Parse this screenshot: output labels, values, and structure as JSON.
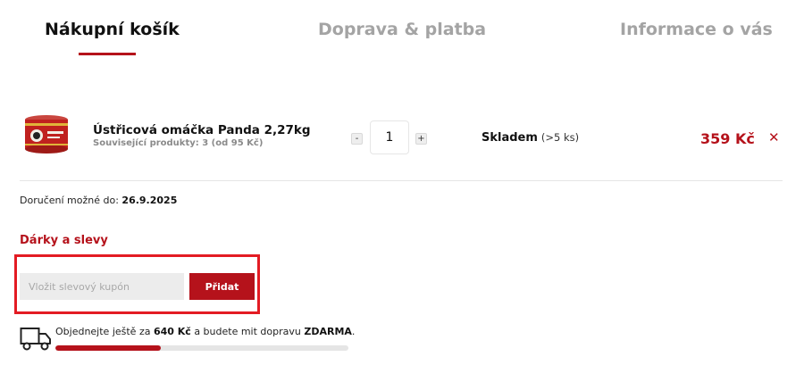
{
  "steps": [
    {
      "label": "Nákupní košík",
      "active": true
    },
    {
      "label": "Doprava & platba",
      "active": false
    },
    {
      "label": "Informace o vás",
      "active": false
    }
  ],
  "cart_item": {
    "name": "Ústřicová omáčka Panda 2,27kg",
    "related": "Související produkty: 3 (od 95 Kč)",
    "quantity": "1",
    "minus_label": "-",
    "plus_label": "+",
    "stock_label": "Skladem",
    "stock_count": "(>5 ks)",
    "price": "359 Kč",
    "remove_label": "✕",
    "image_icon": "product-can-icon"
  },
  "delivery": {
    "label": "Doručení možné do:",
    "date": "26.9.2025"
  },
  "gifts": {
    "title": "Dárky a slevy",
    "coupon_placeholder": "Vložit slevový kupón",
    "add_label": "Přidat"
  },
  "shipping": {
    "text_before": "Objednejte ještě za",
    "amount": "640 Kč",
    "text_middle": "a budete mit dopravu",
    "free_label": "ZDARMA",
    "text_after": ".",
    "progress_fraction": 0.36,
    "icon": "truck-icon"
  },
  "colors": {
    "accent": "#b5121b",
    "highlight": "#e31b23",
    "muted": "#a4a4a4"
  }
}
